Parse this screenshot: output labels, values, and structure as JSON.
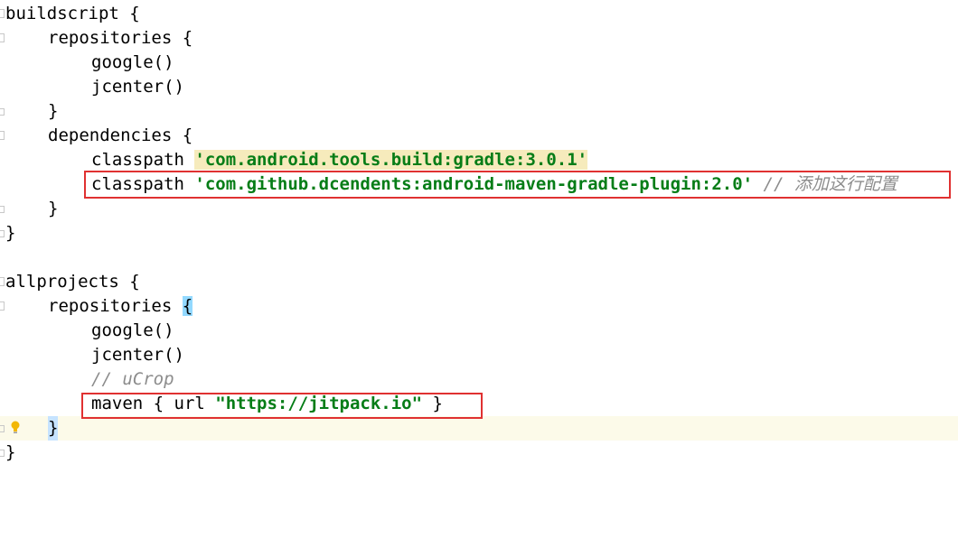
{
  "editor": {
    "lines": [
      {
        "kind": "plain",
        "indent": 0,
        "text": "buildscript {"
      },
      {
        "kind": "plain",
        "indent": 1,
        "text": "repositories {"
      },
      {
        "kind": "plain",
        "indent": 2,
        "text": "google()"
      },
      {
        "kind": "plain",
        "indent": 2,
        "text": "jcenter()"
      },
      {
        "kind": "plain",
        "indent": 1,
        "text": "}"
      },
      {
        "kind": "plain",
        "indent": 1,
        "text": "dependencies {"
      },
      {
        "kind": "classpath",
        "indent": 2,
        "keyword": "classpath ",
        "value": "'com.android.tools.build:gradle:3.0.1'"
      },
      {
        "kind": "classpath_comment",
        "indent": 2,
        "keyword": "classpath ",
        "value": "'com.github.dcendents:android-maven-gradle-plugin:2.0'",
        "comment": " // 添加这行配置"
      },
      {
        "kind": "plain",
        "indent": 1,
        "text": "}"
      },
      {
        "kind": "plain",
        "indent": 0,
        "text": "}"
      },
      {
        "kind": "plain",
        "indent": 0,
        "text": ""
      },
      {
        "kind": "plain",
        "indent": 0,
        "text": "allprojects {"
      },
      {
        "kind": "repo_open",
        "indent": 1,
        "keyword": "repositories ",
        "brace": "{"
      },
      {
        "kind": "plain",
        "indent": 2,
        "text": "google()"
      },
      {
        "kind": "plain",
        "indent": 2,
        "text": "jcenter()"
      },
      {
        "kind": "comment",
        "indent": 2,
        "text": "// uCrop"
      },
      {
        "kind": "maven",
        "indent": 2,
        "before": "maven { url ",
        "value": "\"https://jitpack.io\"",
        "after": " }"
      },
      {
        "kind": "close_brace_hl",
        "indent": 1,
        "text": "}"
      },
      {
        "kind": "plain",
        "indent": 0,
        "text": "}"
      }
    ]
  },
  "colors": {
    "string": "#067d17",
    "comment": "#8c8c8c",
    "highlight_box": "#e03131",
    "matched_brace": "#93d9ff",
    "current_line": "#fcfae9"
  },
  "icons": {
    "gutter_intention": "lightbulb-icon"
  }
}
